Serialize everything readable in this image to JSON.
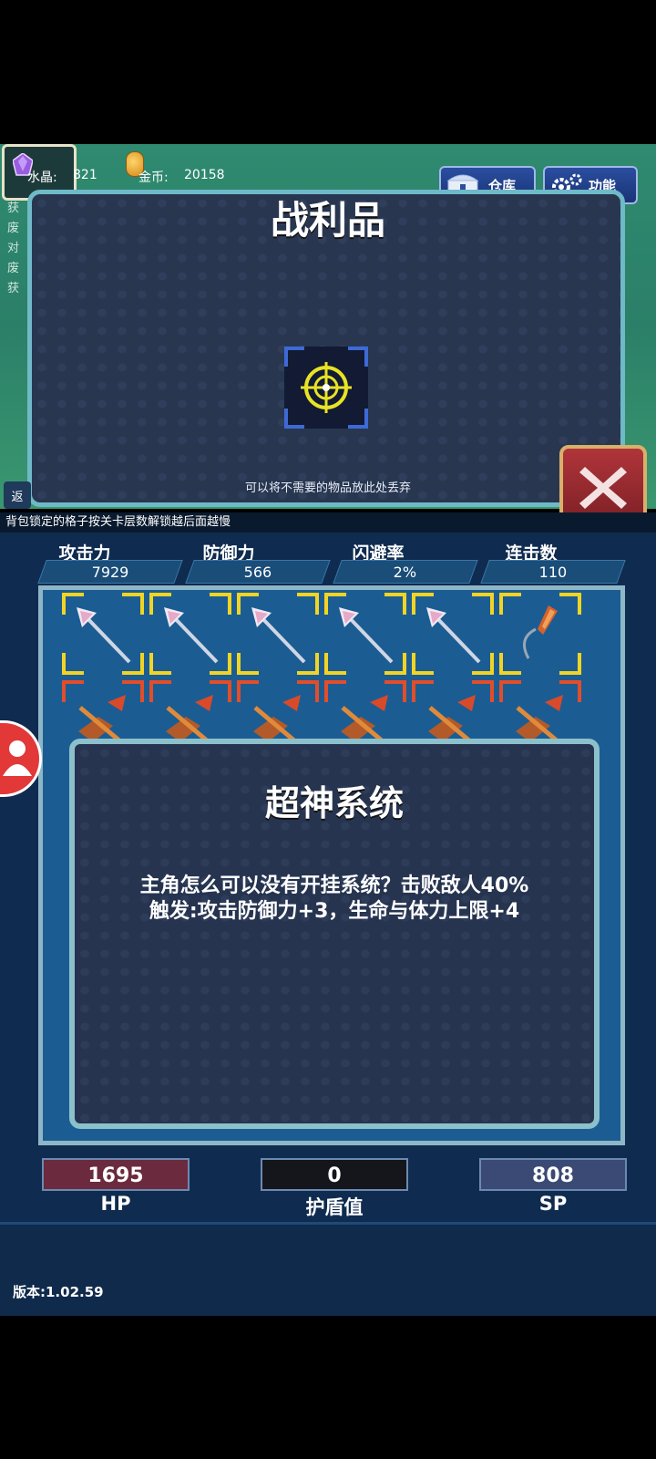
{
  "resources": {
    "crystal_label": "水晶:",
    "crystal_value": "821",
    "coin_label": "金币:",
    "coin_value": "20158"
  },
  "top_buttons": {
    "warehouse_label": "仓库",
    "function_label": "功能"
  },
  "left_strip_text": "获废对废获",
  "left_stub_text": "返",
  "loot_panel": {
    "title": "战利品",
    "hint": "可以将不需要的物品放此处丢弃"
  },
  "lock_notice": "背包锁定的格子按关卡层数解锁越后面越慢",
  "stats": [
    {
      "label": "攻击力",
      "value": "7929"
    },
    {
      "label": "防御力",
      "value": "566"
    },
    {
      "label": "闪避率",
      "value": "2%"
    },
    {
      "label": "连击数",
      "value": "110"
    }
  ],
  "popup": {
    "title": "超神系统",
    "description_line1": "主角怎么可以没有开挂系统？击败敌人40%",
    "description_line2": "触发:攻击防御力+3，生命与体力上限+4"
  },
  "bottom_stats": [
    {
      "value": "1695",
      "label": "HP",
      "color": "#6b2a3d"
    },
    {
      "value": "0",
      "label": "护盾值",
      "color": "#15161c"
    },
    {
      "value": "808",
      "label": "SP",
      "color": "#3a4a74"
    }
  ],
  "version": "版本:1.02.59",
  "icons": [
    "crystal-icon",
    "coin-icon",
    "chest-icon",
    "gear-icon",
    "crosshair-icon",
    "close-icon",
    "user-icon",
    "arrow-icon",
    "crossbow-icon",
    "bow-icon"
  ]
}
